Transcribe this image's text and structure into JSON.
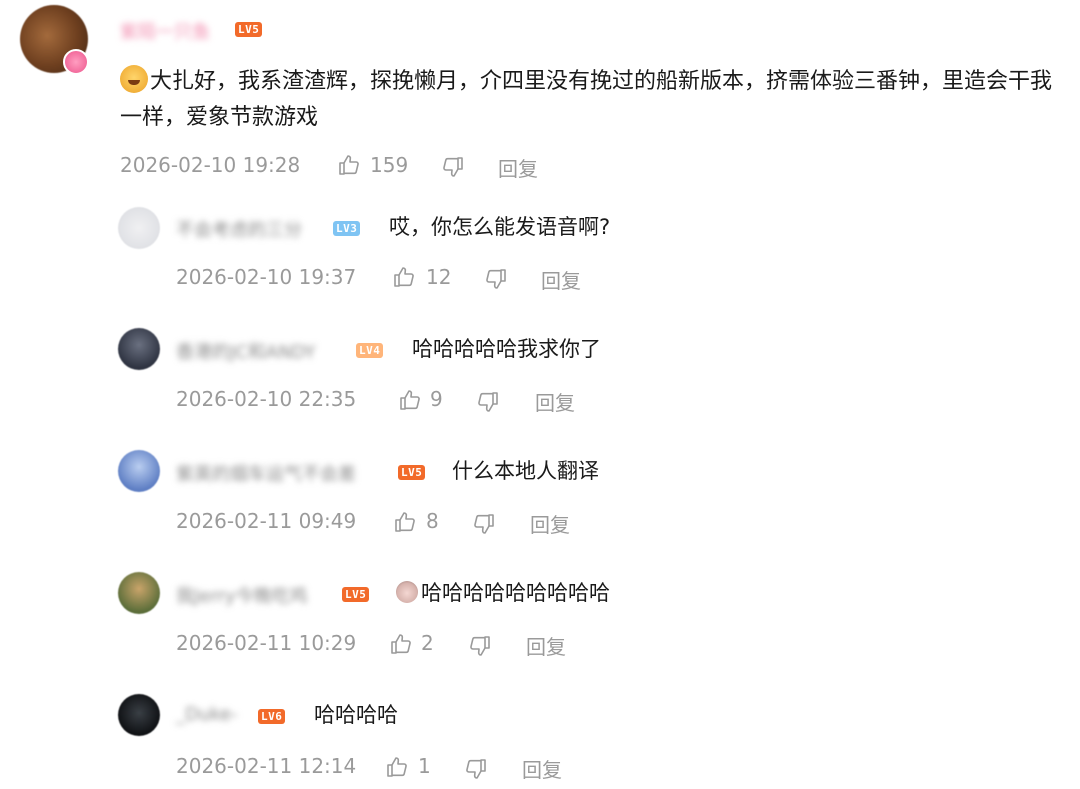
{
  "main_comment": {
    "username": "紫陌一只鱼",
    "level": "LV5",
    "text": "大扎好，我系渣渣辉，探挽懒月，介四里没有挽过的船新版本，挤需体验三番钟，里造会干我一样，爱象节款游戏",
    "timestamp": "2026-02-10 19:28",
    "likes": "159",
    "reply_label": "回复"
  },
  "replies": [
    {
      "username": "不会考虑的三分",
      "level": "LV3",
      "text": "哎，你怎么能发语音啊?",
      "timestamp": "2026-02-10 19:37",
      "likes": "12",
      "reply_label": "回复"
    },
    {
      "username": "香港的JC和ANDY",
      "level": "LV4",
      "text": "哈哈哈哈哈我求你了",
      "timestamp": "2026-02-10 22:35",
      "likes": "9",
      "reply_label": "回复"
    },
    {
      "username": "紫英的烟车运气不会差",
      "level": "LV5",
      "text": "什么本地人翻译",
      "timestamp": "2026-02-11 09:49",
      "likes": "8",
      "reply_label": "回复"
    },
    {
      "username": "我Jerry今晚吃鸡",
      "level": "LV5",
      "text": "哈哈哈哈哈哈哈哈哈",
      "timestamp": "2026-02-11 10:29",
      "likes": "2",
      "reply_label": "回复"
    },
    {
      "username": "_Duke-",
      "level": "LV6",
      "text": "哈哈哈哈",
      "timestamp": "2026-02-11 12:14",
      "likes": "1",
      "reply_label": "回复"
    }
  ],
  "icons": {
    "like": "thumbs-up-icon",
    "dislike": "thumbs-down-icon"
  },
  "colors": {
    "level_orange": "#f26a2a",
    "level_blue": "#7fc4f3",
    "level_peach": "#ffb57a",
    "meta_gray": "#9a9a9a"
  }
}
